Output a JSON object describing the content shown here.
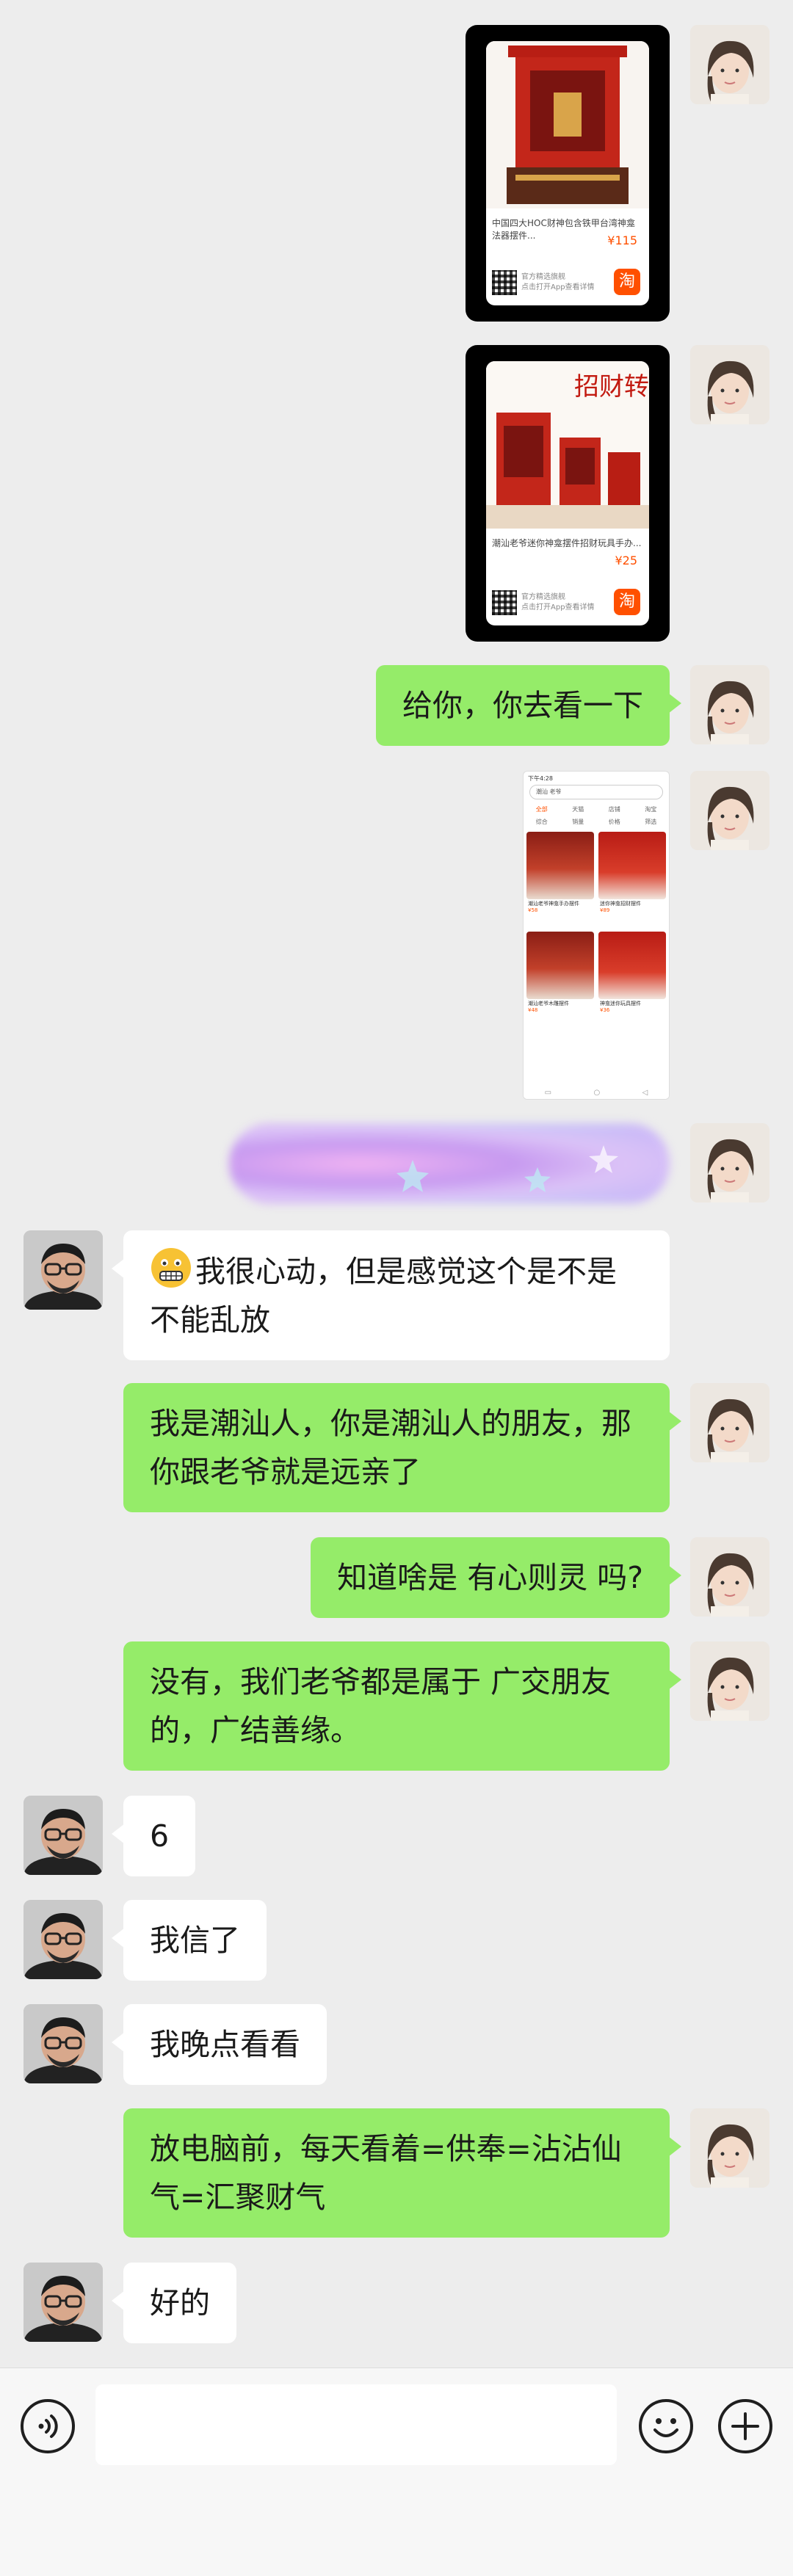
{
  "messages": {
    "card1": {
      "title": "中国四大HOC财神包含铁甲台湾神龛法器摆件...",
      "price": "¥115",
      "shop_line1": "官方精选旗舰",
      "shop_line2": "点击打开App查看详情",
      "badge": "淘"
    },
    "card2": {
      "title": "潮汕老爷迷你神龛摆件招财玩具手办...",
      "price": "¥25",
      "shop_line1": "官方精选旗舰",
      "shop_line2": "点击打开App查看详情",
      "badge": "淘",
      "banner": "招财转运"
    },
    "m3": "给你，你去看一下",
    "shot": {
      "status": "下午4:28",
      "search": "潮汕 老爷",
      "tabs": [
        "全部",
        "天猫",
        "店铺",
        "淘宝"
      ],
      "filters": [
        "综合",
        "销量",
        "价格",
        "筛选"
      ],
      "items": [
        {
          "desc": "潮汕老爷神龛手办摆件",
          "price": "¥58"
        },
        {
          "desc": "迷你神龛招财摆件",
          "price": "¥89"
        },
        {
          "desc": "潮汕老爷木雕摆件",
          "price": "¥48"
        },
        {
          "desc": "神龛迷你玩具摆件",
          "price": "¥36"
        }
      ]
    },
    "m5": "我很心动，但是感觉这个是不是不能乱放",
    "m6": "我是潮汕人，你是潮汕人的朋友，那你跟老爷就是远亲了",
    "m7": "知道啥是 有心则灵 吗?",
    "m8": "没有，我们老爷都是属于 广交朋友的，广结善缘。",
    "m9": "6",
    "m10": "我信了",
    "m11": "我晚点看看",
    "m12": "放电脑前，每天看着=供奉=沾沾仙气=汇聚财气",
    "m13": "好的"
  },
  "input": {
    "placeholder": ""
  },
  "colors": {
    "me_bubble": "#95ec69",
    "friend_bubble": "#ffffff",
    "background": "#ededed"
  }
}
